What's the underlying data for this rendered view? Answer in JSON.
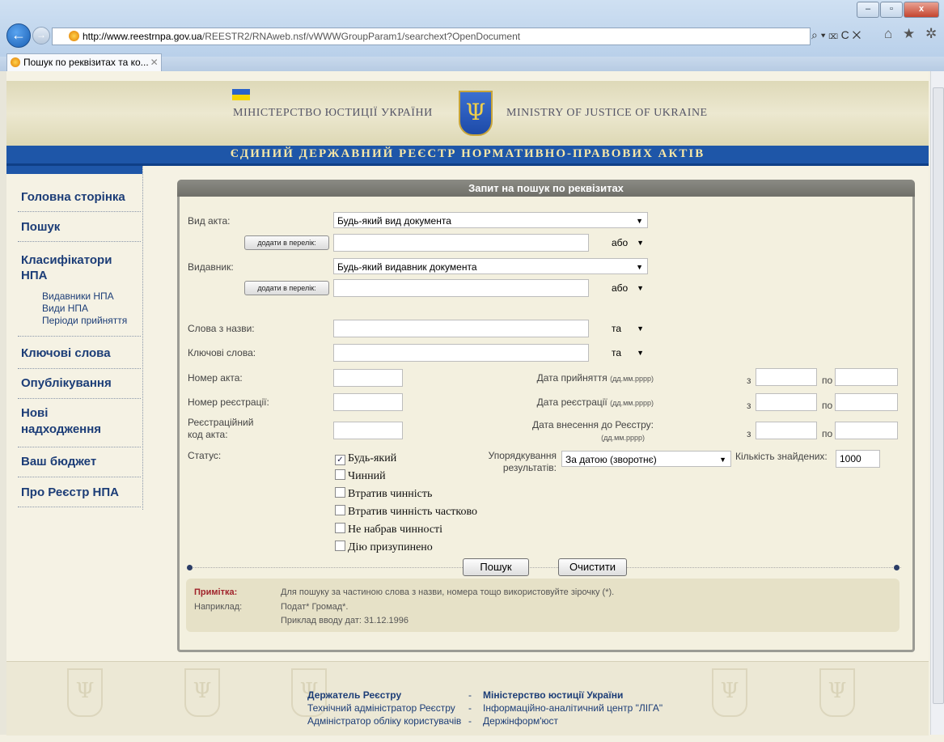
{
  "browser": {
    "url_host": "http://www.reestrnpa.gov.ua",
    "url_path": "/REESTR2/RNAweb.nsf/vWWWGroupParam1/searchext?OpenDocument",
    "tab_title": "Пошук по реквізитах та ко...",
    "controls": "⌕ ▾ ⌧ C ✕",
    "nav_icons": "⌂ ★ ✲",
    "window_buttons": [
      "–",
      "▫",
      "x"
    ]
  },
  "header": {
    "ministry_ua": "МІНІСТЕРСТВО ЮСТИЦІЇ УКРАЇНИ",
    "ministry_en": "MINISTRY OF JUSTICE OF UKRAINE",
    "registry_title": "ЄДИНИЙ ДЕРЖАВНИЙ РЕЄСТР НОРМАТИВНО-ПРАВОВИХ АКТІВ",
    "emblem": "Ψ"
  },
  "sidebar": {
    "items": [
      "Головна сторінка",
      "Пошук",
      "Класифікатори",
      "НПА",
      "Ключові слова",
      "Опублікування",
      "Нові",
      "надходження",
      "Ваш бюджет",
      "Про Реєстр НПА"
    ],
    "subitems": [
      "Видавники НПА",
      "Види НПА",
      "Періоди прийняття"
    ]
  },
  "form": {
    "title": "Запит на пошук по реквізитах",
    "labels": {
      "act_type": "Вид акта:",
      "issuer": "Видавник:",
      "title_words": "Слова з назви:",
      "keywords": "Ключові слова:",
      "act_number": "Номер акта:",
      "reg_number": "Номер реєстрації:",
      "reg_code_1": "Реєстраційний",
      "reg_code_2": "код акта:",
      "status": "Статус:",
      "date_adopted": "Дата прийняття",
      "date_registered": "Дата реєстрації",
      "date_added": "Дата внесення до Реєстру:",
      "date_format": "(дд.мм.рррр)",
      "from": "з",
      "to": "по",
      "sort_1": "Упорядкування",
      "sort_2": "результатів:",
      "found_count": "Кількість знайдених:"
    },
    "act_type_value": "Будь-який вид документа",
    "issuer_value": "Будь-який видавник документа",
    "add_to_list": "додати в перелік:",
    "logic_or": "або",
    "logic_and": "та",
    "sort_value": "За датою (зворотнє)",
    "found_count_value": "1000",
    "statuses": [
      {
        "label": "Будь-який",
        "checked": true
      },
      {
        "label": "Чинний",
        "checked": false
      },
      {
        "label": "Втратив чинність",
        "checked": false
      },
      {
        "label": "Втратив чинність частково",
        "checked": false
      },
      {
        "label": "Не набрав чинності",
        "checked": false
      },
      {
        "label": "Дію призупинено",
        "checked": false
      }
    ],
    "search_button": "Пошук",
    "clear_button": "Очистити",
    "note_label": "Примітка:",
    "note_text": "Для пошуку за частиною слова з назви, номера тощо використовуйте зірочку (*).",
    "example_label": "Наприклад:",
    "example_text": "Подат* Громад*.",
    "date_example": "Приклад вводу дат: 31.12.1996"
  },
  "footer": {
    "holder": "Держатель Реєстру",
    "holder_value": "Міністерство юстиції України",
    "tech_admin": "Технічний адміністратор Реєстру",
    "tech_admin_value": "Інформаційно-аналітичний центр \"ЛІГА\"",
    "users_admin": "Адміністратор обліку користувачів",
    "users_admin_value": "Держінформ'юст",
    "separator": "-",
    "ghost_emblem": "Ψ"
  },
  "colors": {
    "accent": "#1e56a8",
    "note_red": "#a0232b",
    "link": "#1c3d77"
  }
}
